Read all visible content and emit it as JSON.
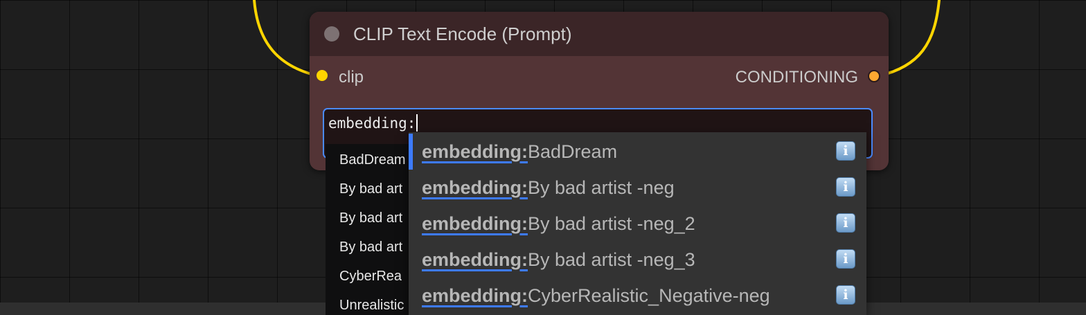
{
  "colors": {
    "canvas": "#1e1e1e",
    "node_body": "#533436",
    "node_header": "#3b2527",
    "wire": "#ffd500",
    "input_border": "#4a8bff",
    "autocomplete_bg": "#333333",
    "selection": "#3d7bff"
  },
  "node": {
    "title": "CLIP Text Encode (Prompt)",
    "inputs": [
      {
        "label": "clip"
      }
    ],
    "outputs": [
      {
        "label": "CONDITIONING"
      }
    ]
  },
  "prompt": {
    "value": "embedding:"
  },
  "background_list": {
    "items": [
      {
        "label": "BadDream"
      },
      {
        "label": "By bad art"
      },
      {
        "label": "By bad art"
      },
      {
        "label": "By bad art"
      },
      {
        "label": "CyberRea"
      },
      {
        "label": "Unrealistic"
      }
    ]
  },
  "autocomplete": {
    "selected_index": 0,
    "info_icon": "info-icon",
    "items": [
      {
        "prefix": "embedding:",
        "name": "BadDream"
      },
      {
        "prefix": "embedding:",
        "name": "By bad artist -neg"
      },
      {
        "prefix": "embedding:",
        "name": "By bad artist -neg_2"
      },
      {
        "prefix": "embedding:",
        "name": "By bad artist -neg_3"
      },
      {
        "prefix": "embedding:",
        "name": "CyberRealistic_Negative-neg"
      }
    ]
  }
}
